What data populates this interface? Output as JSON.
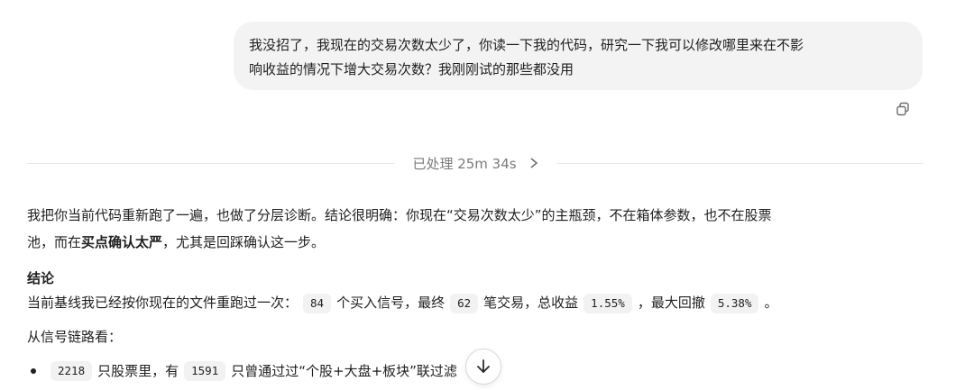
{
  "user_message": {
    "line1": "我没招了，我现在的交易次数太少了，你读一下我的代码，研究一下我可以修改哪里来在不影",
    "line2": "响收益的情况下增大交易次数？我刚刚试的那些都没用"
  },
  "copy_button": {
    "icon": "copy-icon"
  },
  "processed": {
    "label": "已处理 25m 34s",
    "icon": "chevron-right-icon"
  },
  "answer": {
    "intro": {
      "part1": "我把你当前代码重新跑了一遍，也做了分层诊断。结论很明确：你现在“交易次数太少”的主瓶颈，不在箱体参数，也不在股票",
      "part2": "池，而在",
      "bold": "买点确认太严",
      "part3": "，尤其是回踩确认这一步。"
    },
    "conclusion_heading": "结论",
    "baseline": {
      "t1": "当前基线我已经按你现在的文件重跑过一次：",
      "signals": "84",
      "t2": "个买入信号，最终",
      "trades": "62",
      "t3": "笔交易，总收益",
      "return": "1.55%",
      "t4": "，最大回撤",
      "drawdown": "5.38%",
      "t5": "。"
    },
    "chain_heading": "从信号链路看：",
    "bullet1": {
      "count_total": "2218",
      "t1": "只股票里，有",
      "count_passed": "1591",
      "t2": "只曾通过过“个股+大盘+板块”联",
      "t3": "过滤"
    }
  },
  "scroll_button": {
    "icon": "arrow-down-icon"
  }
}
